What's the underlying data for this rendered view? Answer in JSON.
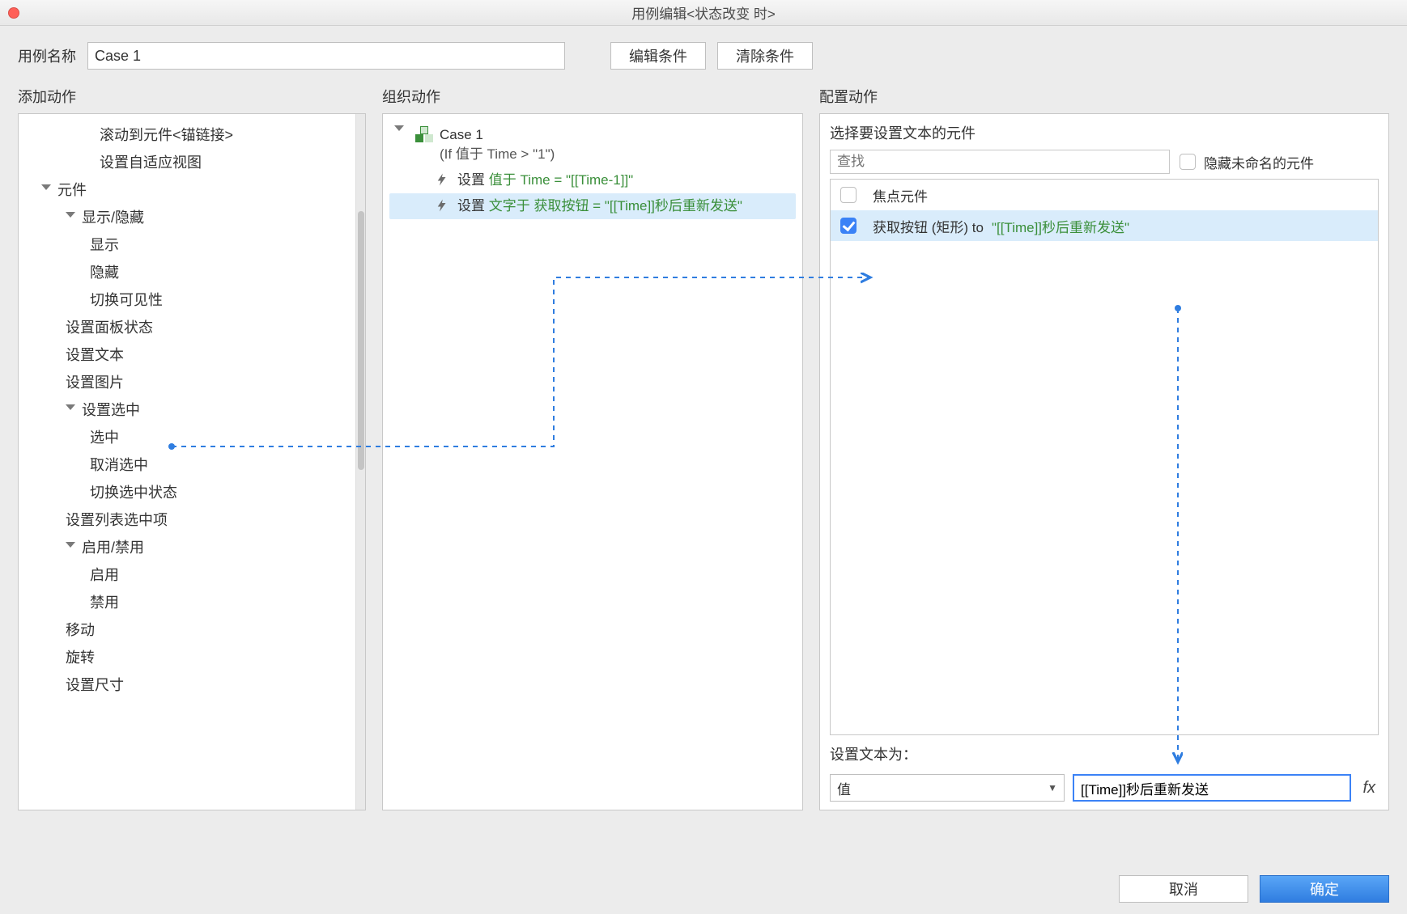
{
  "window": {
    "title": "用例编辑<状态改变 时>"
  },
  "labels": {
    "case_name": "用例名称",
    "add_action": "添加动作",
    "organize_action": "组织动作",
    "configure_action": "配置动作",
    "select_widget": "选择要设置文本的元件",
    "hide_unnamed": "隐藏未命名的元件",
    "set_text_as": "设置文本为："
  },
  "buttons": {
    "edit_condition": "编辑条件",
    "clear_condition": "清除条件",
    "cancel": "取消",
    "ok": "确定"
  },
  "case_name_value": "Case 1",
  "tree": [
    {
      "label": "滚动到元件<锚链接>",
      "indent": "top"
    },
    {
      "label": "设置自适应视图",
      "indent": "top"
    },
    {
      "label": "元件",
      "indent": 0,
      "arrow": true
    },
    {
      "label": "显示/隐藏",
      "indent": 1,
      "arrow": true
    },
    {
      "label": "显示",
      "indent": 2
    },
    {
      "label": "隐藏",
      "indent": 2
    },
    {
      "label": "切换可见性",
      "indent": 2
    },
    {
      "label": "设置面板状态",
      "indent": 1
    },
    {
      "label": "设置文本",
      "indent": 1
    },
    {
      "label": "设置图片",
      "indent": 1
    },
    {
      "label": "设置选中",
      "indent": 1,
      "arrow": true
    },
    {
      "label": "选中",
      "indent": 2
    },
    {
      "label": "取消选中",
      "indent": 2
    },
    {
      "label": "切换选中状态",
      "indent": 2
    },
    {
      "label": "设置列表选中项",
      "indent": 1
    },
    {
      "label": "启用/禁用",
      "indent": 1,
      "arrow": true
    },
    {
      "label": "启用",
      "indent": 2
    },
    {
      "label": "禁用",
      "indent": 2
    },
    {
      "label": "移动",
      "indent": 1
    },
    {
      "label": "旋转",
      "indent": 1
    },
    {
      "label": "设置尺寸",
      "indent": 1
    }
  ],
  "organize": {
    "case_label": "Case 1",
    "condition": "(If 值于 Time > \"1\")",
    "actions": [
      {
        "prefix": "设置 ",
        "green": "值于 Time = \"[[Time-1]]\"",
        "selected": false
      },
      {
        "prefix": "设置 ",
        "green": "文字于 获取按钮 = \"[[Time]]秒后重新发送\"",
        "selected": true
      }
    ]
  },
  "configure": {
    "search_placeholder": "查找",
    "items": [
      {
        "checked": false,
        "label": "焦点元件",
        "to": "",
        "val": "",
        "selected": false
      },
      {
        "checked": true,
        "label": "获取按钮 (矩形) to ",
        "val": "\"[[Time]]秒后重新发送\"",
        "selected": true
      }
    ],
    "combo_value": "值",
    "text_value": "[[Time]]秒后重新发送",
    "fx_label": "fx"
  }
}
